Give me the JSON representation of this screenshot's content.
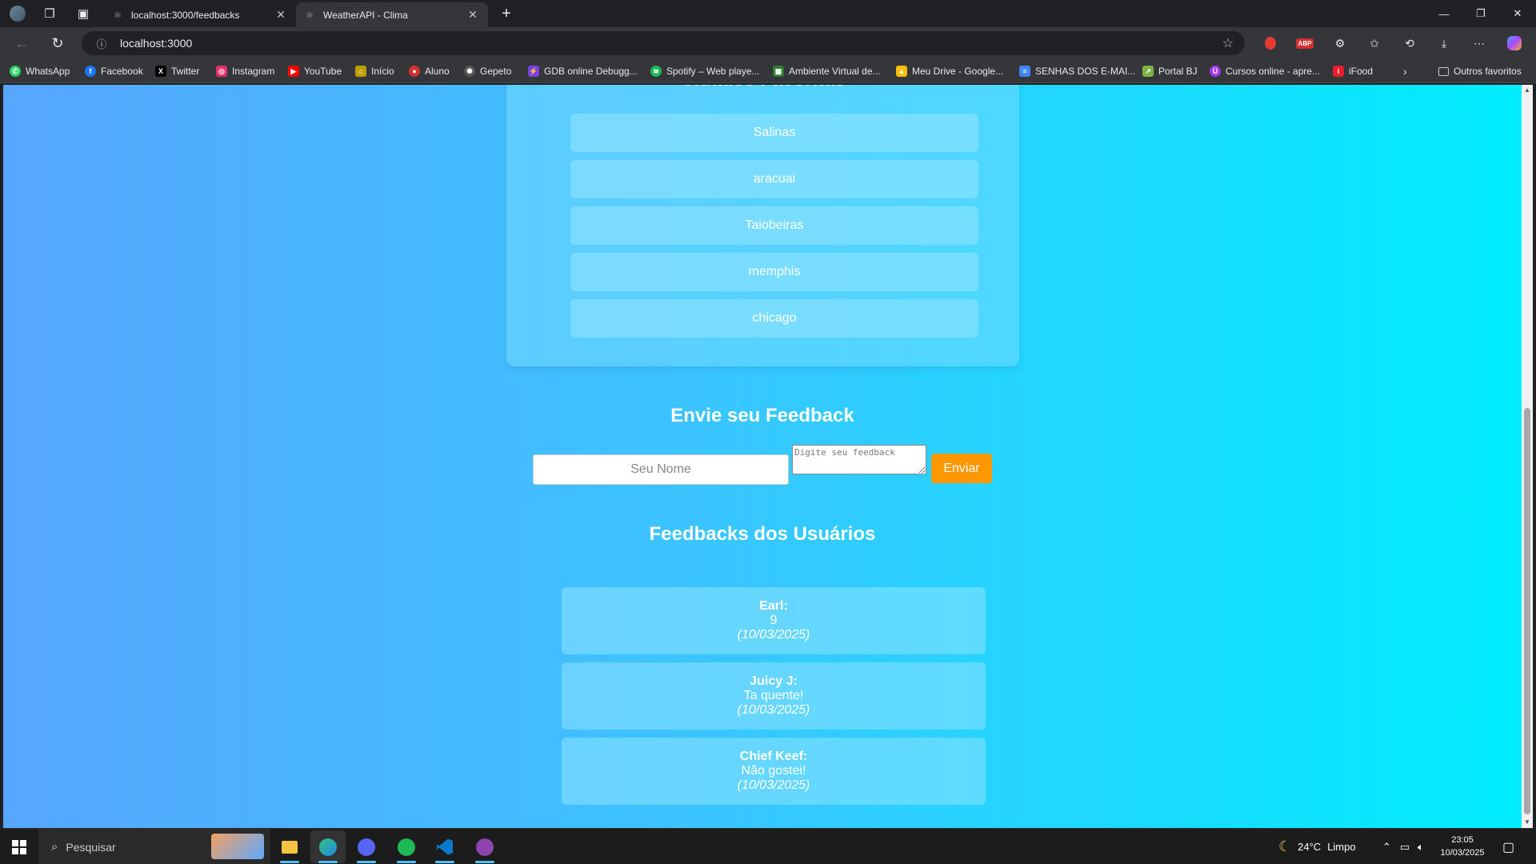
{
  "browser": {
    "tabs": [
      {
        "title": "localhost:3000/feedbacks",
        "active": false
      },
      {
        "title": "WeatherAPI - Clima",
        "active": true
      }
    ],
    "close_symbol": "✕",
    "new_tab_symbol": "+",
    "url": "localhost:3000",
    "bookmarks": [
      {
        "label": "WhatsApp",
        "icon": "whatsapp-icon",
        "color": "#25d366"
      },
      {
        "label": "Facebook",
        "icon": "facebook-icon",
        "color": "#1877f2"
      },
      {
        "label": "Twitter",
        "icon": "x-icon",
        "color": "#000000"
      },
      {
        "label": "Instagram",
        "icon": "instagram-icon",
        "color": "#e1306c"
      },
      {
        "label": "YouTube",
        "icon": "youtube-icon",
        "color": "#ff0000"
      },
      {
        "label": "Início",
        "icon": "home-icon",
        "color": "#c0a000"
      },
      {
        "label": "Aluno",
        "icon": "aluno-icon",
        "color": "#d32f2f"
      },
      {
        "label": "Gepeto",
        "icon": "openai-icon",
        "color": "#555555"
      },
      {
        "label": "GDB online Debugg...",
        "icon": "gdb-icon",
        "color": "#7b3fe4"
      },
      {
        "label": "Spotify – Web playe...",
        "icon": "spotify-icon",
        "color": "#1db954"
      },
      {
        "label": "Ambiente Virtual de...",
        "icon": "moodle-icon",
        "color": "#2e7d32"
      },
      {
        "label": "Meu Drive - Google...",
        "icon": "drive-icon",
        "color": "#fbbc04"
      },
      {
        "label": "SENHAS DOS E-MAI...",
        "icon": "docs-icon",
        "color": "#4285f4"
      },
      {
        "label": "Portal BJ",
        "icon": "portal-icon",
        "color": "#7cb342"
      },
      {
        "label": "Cursos online - apre...",
        "icon": "udemy-icon",
        "color": "#a435f0"
      },
      {
        "label": "iFood",
        "icon": "ifood-icon",
        "color": "#ea1d2c"
      }
    ],
    "other_favorites": "Outros favoritos",
    "colors": {
      "titlebar": "#202124",
      "toolbar": "#35363a"
    }
  },
  "page": {
    "favorites_title": "Cidades Favoritas",
    "cities": [
      "Salinas",
      "aracuai",
      "Taiobeiras",
      "memphis",
      "chicago"
    ],
    "feedback_title": "Envie seu Feedback",
    "name_placeholder": "Seu Nome",
    "feedback_placeholder": "Digite seu feedback",
    "send_label": "Enviar",
    "feedbacks_title": "Feedbacks dos Usuários",
    "feedbacks": [
      {
        "name": "Earl:",
        "message": "9",
        "date": "(10/03/2025)"
      },
      {
        "name": "Juicy J:",
        "message": "Ta quente!",
        "date": "(10/03/2025)"
      },
      {
        "name": "Chief Keef:",
        "message": "Não gostei!",
        "date": "(10/03/2025)"
      }
    ],
    "colors": {
      "button": "#ff9800",
      "gradient_start": "#57a6ff",
      "gradient_end": "#00eeff"
    }
  },
  "taskbar": {
    "search_placeholder": "Pesquisar",
    "weather_temp": "24°C",
    "weather_desc": "Limpo",
    "time": "23:05",
    "date": "10/03/2025"
  }
}
